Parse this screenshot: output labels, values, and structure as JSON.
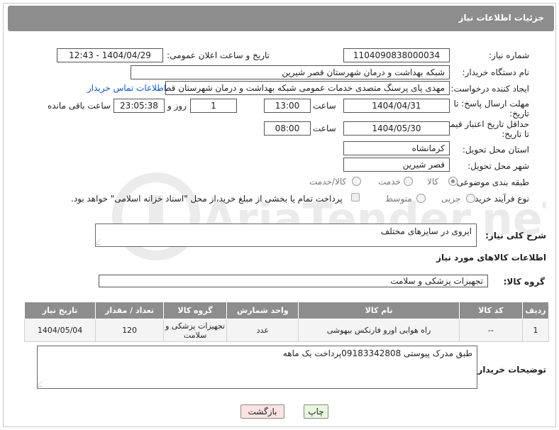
{
  "header": {
    "title": "جزئیات اطلاعات نیاز"
  },
  "form": {
    "need_number_label": "شماره نیاز:",
    "need_number": "1104090838000034",
    "announce_label": "تاریخ و ساعت اعلان عمومی:",
    "announce_value": "1404/04/29 - 12:43",
    "buyer_org_label": "نام دستگاه خریدار:",
    "buyer_org": "شبکه بهداشت و درمان شهرستان قصر شیرین",
    "creator_label": "ایجاد کننده درخواست:",
    "creator": "مهدی پای پرسنگ متصدی خدمات عمومی شبکه بهداشت و درمان شهرستان قصر شیرین",
    "contact_link": "اطلاعات تماس خریدار",
    "reply_deadline_label_1": "مهلت ارسال پاسخ: تا",
    "reply_deadline_label_2": "تاریخ:",
    "reply_date": "1404/04/31",
    "time_label": "ساعت",
    "reply_time": "13:00",
    "days_value": "1",
    "days_label": "روز و",
    "remaining_time": "23:05:38",
    "remaining_label": "ساعت باقی مانده",
    "price_validity_label_1": "حداقل تاریخ اعتبار قیمت:",
    "price_validity_label_2": "تا تاریخ:",
    "price_date": "1404/05/30",
    "price_time": "08:00",
    "province_label": "استان محل تحویل:",
    "province": "کرمانشاه",
    "city_label": "شهر محل تحویل:",
    "city": "قصر شیرین",
    "category_label": "طبقه بندی موضوعی:",
    "category_options": [
      "کالا",
      "خدمت",
      "کالا/خدمت"
    ],
    "process_label": "نوع فرآیند خرید :",
    "process_options": [
      "جزیی",
      "متوسط"
    ],
    "payment_note": "پرداخت تمام یا بخشی از مبلغ خرید،از محل \"اسناد خزانه اسلامی\" خواهد بود."
  },
  "description": {
    "label": "شرح کلی نیاز:",
    "value": "ایروی در سایزهای مختلف"
  },
  "goods_section": {
    "title": "اطلاعات کالاهای مورد نیاز",
    "group_label": "گروه کالا:",
    "group_value": "تجهیزات پزشکی و سلامت"
  },
  "table": {
    "headers": [
      "ردیف",
      "کد کالا",
      "نام کالا",
      "واحد شمارش",
      "گروه کالا",
      "تعداد / مقدار",
      "تاریخ نیاز"
    ],
    "rows": [
      [
        "1",
        "--",
        "راه هوایی اورو فارنکس بیهوشی",
        "عدد",
        "تجهیزات پزشکی و سلامت",
        "120",
        "1404/05/04"
      ]
    ]
  },
  "buyer_notes": {
    "label": "توضیحات خریدار:",
    "value": "طبق مدرک پیوستی 09183342808پرداخت یک ماهه"
  },
  "buttons": {
    "print": "چاپ",
    "back": "بازگشت"
  },
  "watermark": {
    "text": "AriaTender.neT"
  }
}
